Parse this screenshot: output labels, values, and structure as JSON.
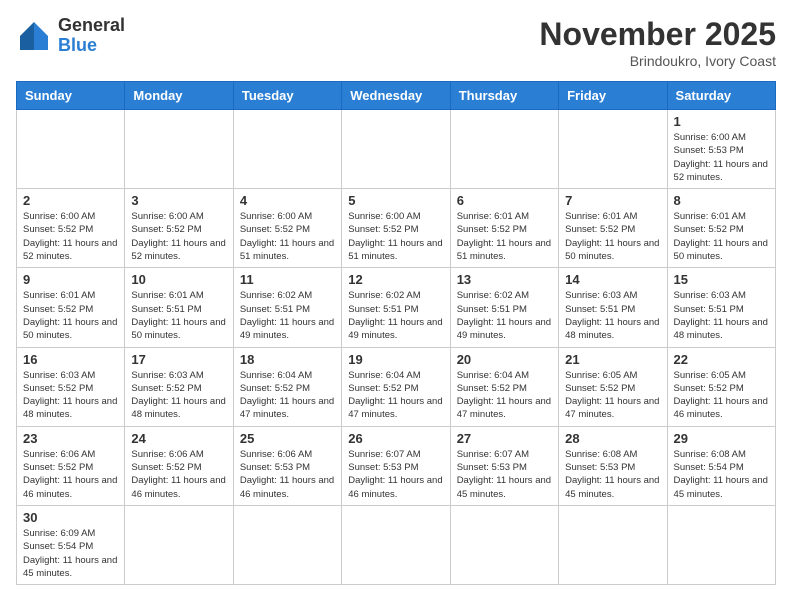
{
  "header": {
    "logo_general": "General",
    "logo_blue": "Blue",
    "month_title": "November 2025",
    "location": "Brindoukro, Ivory Coast"
  },
  "days_of_week": [
    "Sunday",
    "Monday",
    "Tuesday",
    "Wednesday",
    "Thursday",
    "Friday",
    "Saturday"
  ],
  "weeks": [
    [
      {
        "day": "",
        "info": ""
      },
      {
        "day": "",
        "info": ""
      },
      {
        "day": "",
        "info": ""
      },
      {
        "day": "",
        "info": ""
      },
      {
        "day": "",
        "info": ""
      },
      {
        "day": "",
        "info": ""
      },
      {
        "day": "1",
        "info": "Sunrise: 6:00 AM\nSunset: 5:53 PM\nDaylight: 11 hours and 52 minutes."
      }
    ],
    [
      {
        "day": "2",
        "info": "Sunrise: 6:00 AM\nSunset: 5:52 PM\nDaylight: 11 hours and 52 minutes."
      },
      {
        "day": "3",
        "info": "Sunrise: 6:00 AM\nSunset: 5:52 PM\nDaylight: 11 hours and 52 minutes."
      },
      {
        "day": "4",
        "info": "Sunrise: 6:00 AM\nSunset: 5:52 PM\nDaylight: 11 hours and 51 minutes."
      },
      {
        "day": "5",
        "info": "Sunrise: 6:00 AM\nSunset: 5:52 PM\nDaylight: 11 hours and 51 minutes."
      },
      {
        "day": "6",
        "info": "Sunrise: 6:01 AM\nSunset: 5:52 PM\nDaylight: 11 hours and 51 minutes."
      },
      {
        "day": "7",
        "info": "Sunrise: 6:01 AM\nSunset: 5:52 PM\nDaylight: 11 hours and 50 minutes."
      },
      {
        "day": "8",
        "info": "Sunrise: 6:01 AM\nSunset: 5:52 PM\nDaylight: 11 hours and 50 minutes."
      }
    ],
    [
      {
        "day": "9",
        "info": "Sunrise: 6:01 AM\nSunset: 5:52 PM\nDaylight: 11 hours and 50 minutes."
      },
      {
        "day": "10",
        "info": "Sunrise: 6:01 AM\nSunset: 5:51 PM\nDaylight: 11 hours and 50 minutes."
      },
      {
        "day": "11",
        "info": "Sunrise: 6:02 AM\nSunset: 5:51 PM\nDaylight: 11 hours and 49 minutes."
      },
      {
        "day": "12",
        "info": "Sunrise: 6:02 AM\nSunset: 5:51 PM\nDaylight: 11 hours and 49 minutes."
      },
      {
        "day": "13",
        "info": "Sunrise: 6:02 AM\nSunset: 5:51 PM\nDaylight: 11 hours and 49 minutes."
      },
      {
        "day": "14",
        "info": "Sunrise: 6:03 AM\nSunset: 5:51 PM\nDaylight: 11 hours and 48 minutes."
      },
      {
        "day": "15",
        "info": "Sunrise: 6:03 AM\nSunset: 5:51 PM\nDaylight: 11 hours and 48 minutes."
      }
    ],
    [
      {
        "day": "16",
        "info": "Sunrise: 6:03 AM\nSunset: 5:52 PM\nDaylight: 11 hours and 48 minutes."
      },
      {
        "day": "17",
        "info": "Sunrise: 6:03 AM\nSunset: 5:52 PM\nDaylight: 11 hours and 48 minutes."
      },
      {
        "day": "18",
        "info": "Sunrise: 6:04 AM\nSunset: 5:52 PM\nDaylight: 11 hours and 47 minutes."
      },
      {
        "day": "19",
        "info": "Sunrise: 6:04 AM\nSunset: 5:52 PM\nDaylight: 11 hours and 47 minutes."
      },
      {
        "day": "20",
        "info": "Sunrise: 6:04 AM\nSunset: 5:52 PM\nDaylight: 11 hours and 47 minutes."
      },
      {
        "day": "21",
        "info": "Sunrise: 6:05 AM\nSunset: 5:52 PM\nDaylight: 11 hours and 47 minutes."
      },
      {
        "day": "22",
        "info": "Sunrise: 6:05 AM\nSunset: 5:52 PM\nDaylight: 11 hours and 46 minutes."
      }
    ],
    [
      {
        "day": "23",
        "info": "Sunrise: 6:06 AM\nSunset: 5:52 PM\nDaylight: 11 hours and 46 minutes."
      },
      {
        "day": "24",
        "info": "Sunrise: 6:06 AM\nSunset: 5:52 PM\nDaylight: 11 hours and 46 minutes."
      },
      {
        "day": "25",
        "info": "Sunrise: 6:06 AM\nSunset: 5:53 PM\nDaylight: 11 hours and 46 minutes."
      },
      {
        "day": "26",
        "info": "Sunrise: 6:07 AM\nSunset: 5:53 PM\nDaylight: 11 hours and 46 minutes."
      },
      {
        "day": "27",
        "info": "Sunrise: 6:07 AM\nSunset: 5:53 PM\nDaylight: 11 hours and 45 minutes."
      },
      {
        "day": "28",
        "info": "Sunrise: 6:08 AM\nSunset: 5:53 PM\nDaylight: 11 hours and 45 minutes."
      },
      {
        "day": "29",
        "info": "Sunrise: 6:08 AM\nSunset: 5:54 PM\nDaylight: 11 hours and 45 minutes."
      }
    ],
    [
      {
        "day": "30",
        "info": "Sunrise: 6:09 AM\nSunset: 5:54 PM\nDaylight: 11 hours and 45 minutes."
      },
      {
        "day": "",
        "info": ""
      },
      {
        "day": "",
        "info": ""
      },
      {
        "day": "",
        "info": ""
      },
      {
        "day": "",
        "info": ""
      },
      {
        "day": "",
        "info": ""
      },
      {
        "day": "",
        "info": ""
      }
    ]
  ]
}
